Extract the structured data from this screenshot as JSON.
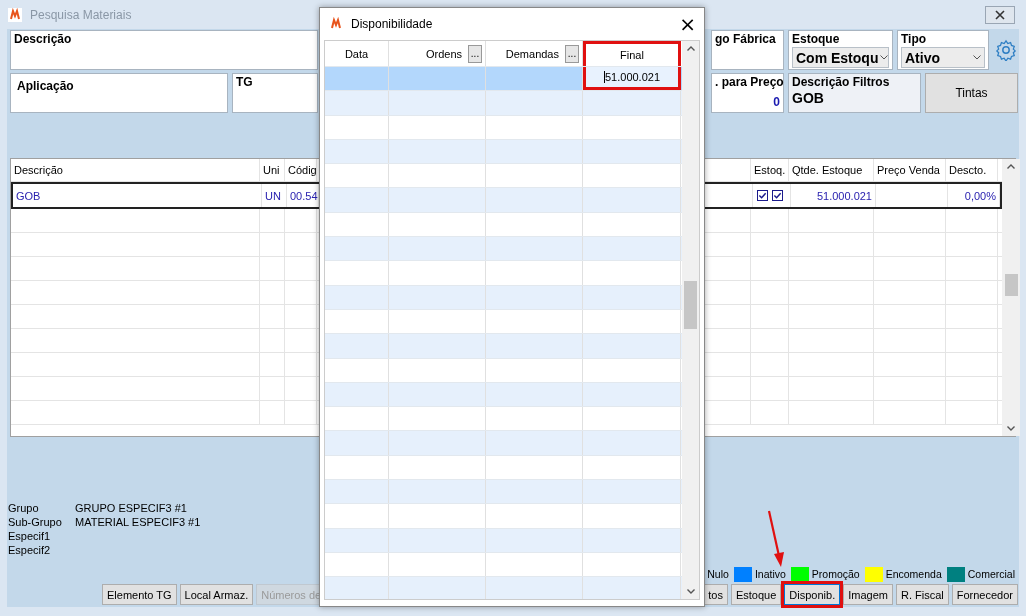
{
  "window": {
    "title": "Pesquisa Materiais"
  },
  "filters": {
    "descricao": {
      "label": "Descrição"
    },
    "fabrica": {
      "label": "go Fábrica"
    },
    "estoque": {
      "label": "Estoque",
      "value": "Com Estoqu"
    },
    "tipo": {
      "label": "Tipo",
      "value": "Ativo"
    },
    "aplicacao": {
      "label": "Aplicação"
    },
    "tg": {
      "label": "TG"
    },
    "preco": {
      "label": ". para Preço",
      "value": "0"
    },
    "descricao_filtros": {
      "label": "Descrição Filtros",
      "value": "GOB"
    }
  },
  "tintas_button": "Tintas",
  "table": {
    "columns": [
      {
        "label": "Descrição"
      },
      {
        "label": "Uni"
      },
      {
        "label": "Códig"
      },
      {
        "label": "Estoq."
      },
      {
        "label": "Qtde. Estoque"
      },
      {
        "label": "Preço Venda"
      },
      {
        "label": "Descto."
      }
    ],
    "rows": [
      {
        "descricao": "GOB",
        "uni": "UN",
        "codigo": "00.54",
        "estoq_1": true,
        "estoq_2": true,
        "qtde": "51.000.021",
        "descto": "0,00%",
        "selected": true
      }
    ]
  },
  "info": [
    {
      "label": "Grupo",
      "value": "GRUPO ESPECIF3 #1"
    },
    {
      "label": "Sub-Grupo",
      "value": "MATERIAL ESPECIF3 #1"
    },
    {
      "label": "Especif1"
    },
    {
      "label": "Especif2"
    }
  ],
  "legend": [
    {
      "label": "Nulo"
    },
    {
      "label": "Inativo",
      "color": "#0080ff"
    },
    {
      "label": "Promoção",
      "color": "#00ff00"
    },
    {
      "label": "Encomenda",
      "color": "#ffff00"
    },
    {
      "label": "Comercial",
      "color": "#008080"
    }
  ],
  "buttons_left": [
    {
      "label": "Elemento TG",
      "disabled": false,
      "highlighted": false
    },
    {
      "label": "Local Armaz.",
      "disabled": false,
      "highlighted": false
    },
    {
      "label": "Números de",
      "disabled": true,
      "highlighted": false
    }
  ],
  "buttons_right": [
    {
      "label": "tos",
      "disabled": false,
      "highlighted": false
    },
    {
      "label": "Estoque",
      "disabled": false,
      "highlighted": false
    },
    {
      "label": "Disponib.",
      "disabled": false,
      "highlighted": true
    },
    {
      "label": "Imagem",
      "disabled": false,
      "highlighted": false
    },
    {
      "label": "R. Fiscal",
      "disabled": false,
      "highlighted": false
    },
    {
      "label": "Fornecedor",
      "disabled": false,
      "highlighted": false
    }
  ],
  "dialog": {
    "title": "Disponibilidade",
    "close": "×",
    "columns": [
      {
        "label": "Data",
        "highlighted": false
      },
      {
        "label": "Ordens",
        "button_label": "...",
        "highlighted": false
      },
      {
        "label": "Demandas",
        "button_label": "...",
        "highlighted": false
      },
      {
        "label": "Final",
        "highlighted": true
      }
    ],
    "rows": [
      {
        "final": "51.000.021",
        "selected": true,
        "editing": true
      }
    ]
  }
}
